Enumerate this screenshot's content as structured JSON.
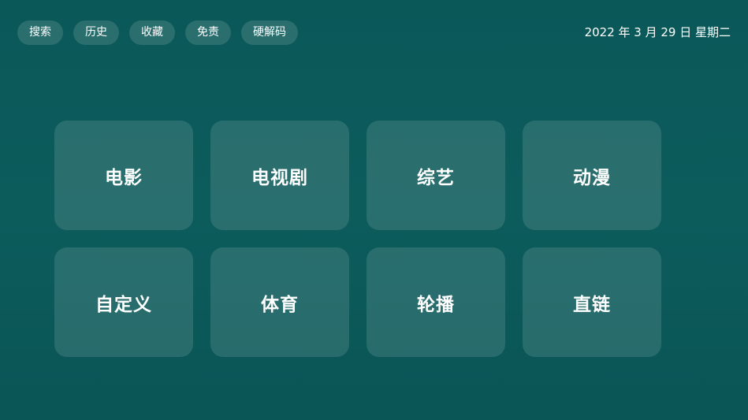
{
  "topbar": {
    "nav": [
      {
        "label": "搜索"
      },
      {
        "label": "历史"
      },
      {
        "label": "收藏"
      },
      {
        "label": "免责"
      },
      {
        "label": "硬解码"
      }
    ],
    "datetime": "2022 年 3 月 29 日 星期二"
  },
  "categories": [
    {
      "label": "电影"
    },
    {
      "label": "电视剧"
    },
    {
      "label": "综艺"
    },
    {
      "label": "动漫"
    },
    {
      "label": "自定义"
    },
    {
      "label": "体育"
    },
    {
      "label": "轮播"
    },
    {
      "label": "直链"
    }
  ],
  "colors": {
    "background": "#0c5a5a",
    "tile": "#26696a",
    "text": "#ffffff"
  }
}
